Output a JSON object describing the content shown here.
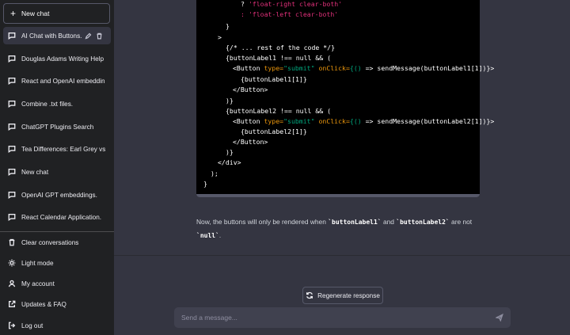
{
  "sidebar": {
    "new_chat_label": "New chat",
    "chats": [
      {
        "label": "AI Chat with Buttons."
      },
      {
        "label": "Douglas Adams Writing Help"
      },
      {
        "label": "React and OpenAI embeddin"
      },
      {
        "label": "Combine .txt files."
      },
      {
        "label": "ChatGPT Plugins Search"
      },
      {
        "label": "Tea Differences: Earl Grey vs"
      },
      {
        "label": "New chat"
      },
      {
        "label": "OpenAI GPT embeddings."
      },
      {
        "label": "React Calendar Application."
      }
    ],
    "bottom": {
      "clear": "Clear conversations",
      "light": "Light mode",
      "account": "My account",
      "updates": "Updates & FAQ",
      "logout": "Log out"
    }
  },
  "code": {
    "l1_q": "? ",
    "l1_s": "'float-right clear-both'",
    "l2_q": ": ",
    "l2_s": "'float-left clear-both'",
    "l3": "}",
    "l4": ">",
    "l5": "{/* ... rest of the code */}",
    "l6": "{buttonLabel1 !== null && (",
    "l7_a": "<Button ",
    "l7_b": "type=",
    "l7_c": "\"submit\"",
    "l7_d": " onClick=",
    "l7_e": "{()",
    "l7_f": " => sendMessage(buttonLabel1[1])}>",
    "l8": "{buttonLabel1[1]}",
    "l9": "</Button>",
    "l10": ")}",
    "l11": "{buttonLabel2 !== null && (",
    "l12_a": "<Button ",
    "l12_b": "type=",
    "l12_c": "\"submit\"",
    "l12_d": " onClick=",
    "l12_e": "{()",
    "l12_f": " => sendMessage(buttonLabel2[1])}>",
    "l13": "{buttonLabel2[1]}",
    "l14": "</Button>",
    "l15": ")}",
    "l16": "</div>",
    "l17": ");",
    "l18": "}"
  },
  "answer": {
    "t1": "Now, the buttons will only be rendered when ",
    "c1": "`buttonLabel1`",
    "t2": " and ",
    "c2": "`buttonLabel2`",
    "t3": " are not ",
    "c3": "`null`",
    "t4": "."
  },
  "regenerate_label": "Regenerate response",
  "input_placeholder": "Send a message...",
  "colors": {
    "sidebar_bg": "#202123",
    "main_bg": "#343541",
    "code_bg": "#000000",
    "string": "#df3079",
    "attr": "#e9950c",
    "green_string": "#00a67d"
  }
}
